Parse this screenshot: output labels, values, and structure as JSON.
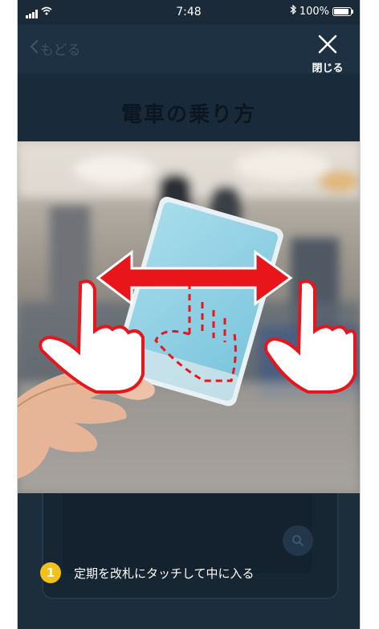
{
  "status_bar": {
    "time": "7:48",
    "battery": "100%",
    "battery_level": 1.0
  },
  "nav": {
    "back_label": "もどる",
    "close_label": "閉じる"
  },
  "page": {
    "title": "電車の乗り方"
  },
  "step": {
    "number": "1",
    "text": "定期を改札にタッチして中に入る"
  },
  "colors": {
    "background": "#1a2a38",
    "accent_badge": "#f3c11c",
    "arrow": "#e8151b",
    "card": "#8fd0e3"
  },
  "icons": {
    "signal": "signal-icon",
    "wifi": "wifi-icon",
    "bluetooth": "bluetooth-icon",
    "battery": "battery-icon",
    "close": "close-icon",
    "search": "search-icon"
  }
}
